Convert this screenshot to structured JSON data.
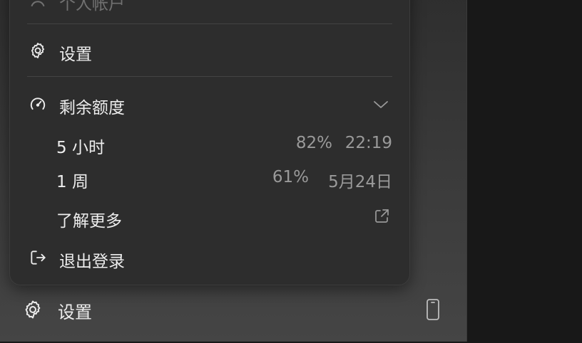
{
  "popup_menu": {
    "top_item_label": "个人帐户",
    "settings_label": "设置",
    "quota": {
      "label": "剩余额度",
      "rows": [
        {
          "label": "5 小时",
          "percent": "82%",
          "reset": "22:19"
        },
        {
          "label": "1 周",
          "percent": "61%",
          "reset": "5月24日"
        }
      ],
      "learn_more_label": "了解更多"
    },
    "logout_label": "退出登录"
  },
  "sidebar_footer": {
    "settings_label": "设置"
  },
  "icons": {
    "top_item": "user-icon",
    "settings": "gear-icon",
    "quota": "gauge-icon",
    "expand": "chevron-down-icon",
    "learn_more": "external-link-icon",
    "logout": "logout-icon",
    "device": "phone-icon"
  },
  "colors": {
    "popup_bg": "#2d2d2d",
    "text": "#ededed",
    "muted_text": "#9a9a9a",
    "divider": "#434343",
    "right_panel": "#181818"
  }
}
